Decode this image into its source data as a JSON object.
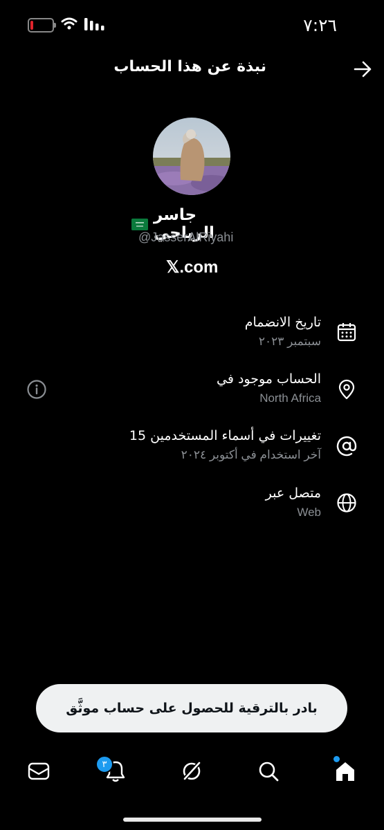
{
  "status_bar": {
    "time": "٧:٢٦"
  },
  "header": {
    "title": "نبذة عن هذا الحساب"
  },
  "profile": {
    "name": "جاسر الرياحي",
    "handle": "@JasserAlRiyahi",
    "site": "𝕏.com"
  },
  "info_rows": [
    {
      "icon": "calendar-icon",
      "title": "تاريخ الانضمام",
      "subtitle": "سبتمبر ٢٠٢٣"
    },
    {
      "icon": "location-pin-icon",
      "title": "الحساب موجود في",
      "subtitle": "North Africa"
    },
    {
      "icon": "at-sign-icon",
      "title": "15 تغييرات في أسماء المستخدمين",
      "subtitle": "آخر استخدام في أكتوبر ٢٠٢٤"
    },
    {
      "icon": "globe-icon",
      "title": "متصل عبر",
      "subtitle": "Web"
    }
  ],
  "upgrade": {
    "label": "بادر بالترقية للحصول على حساب موثَّق"
  },
  "tab_bar": {
    "notifications_badge": "٣"
  },
  "colors": {
    "accent": "#1d9bf0",
    "muted": "#8b8f94",
    "background": "#000000"
  }
}
